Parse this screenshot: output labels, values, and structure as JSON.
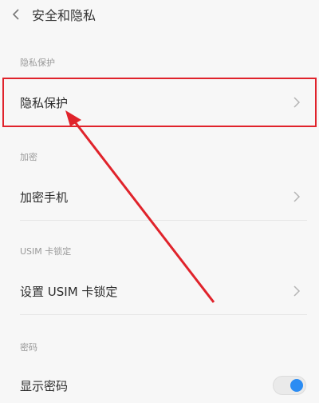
{
  "header": {
    "title": "安全和隐私",
    "back_icon": "chevron-left-icon"
  },
  "sections": {
    "privacy": {
      "label": "隐私保护",
      "item_label": "隐私保护"
    },
    "encryption": {
      "label": "加密",
      "item_label": "加密手机"
    },
    "usim": {
      "label": "USIM 卡锁定",
      "item_label": "设置 USIM 卡锁定"
    },
    "password": {
      "label": "密码",
      "item_label": "显示密码",
      "toggle_on": true
    }
  },
  "colors": {
    "accent": "#2b8cf3",
    "annotation": "#e0232b"
  }
}
